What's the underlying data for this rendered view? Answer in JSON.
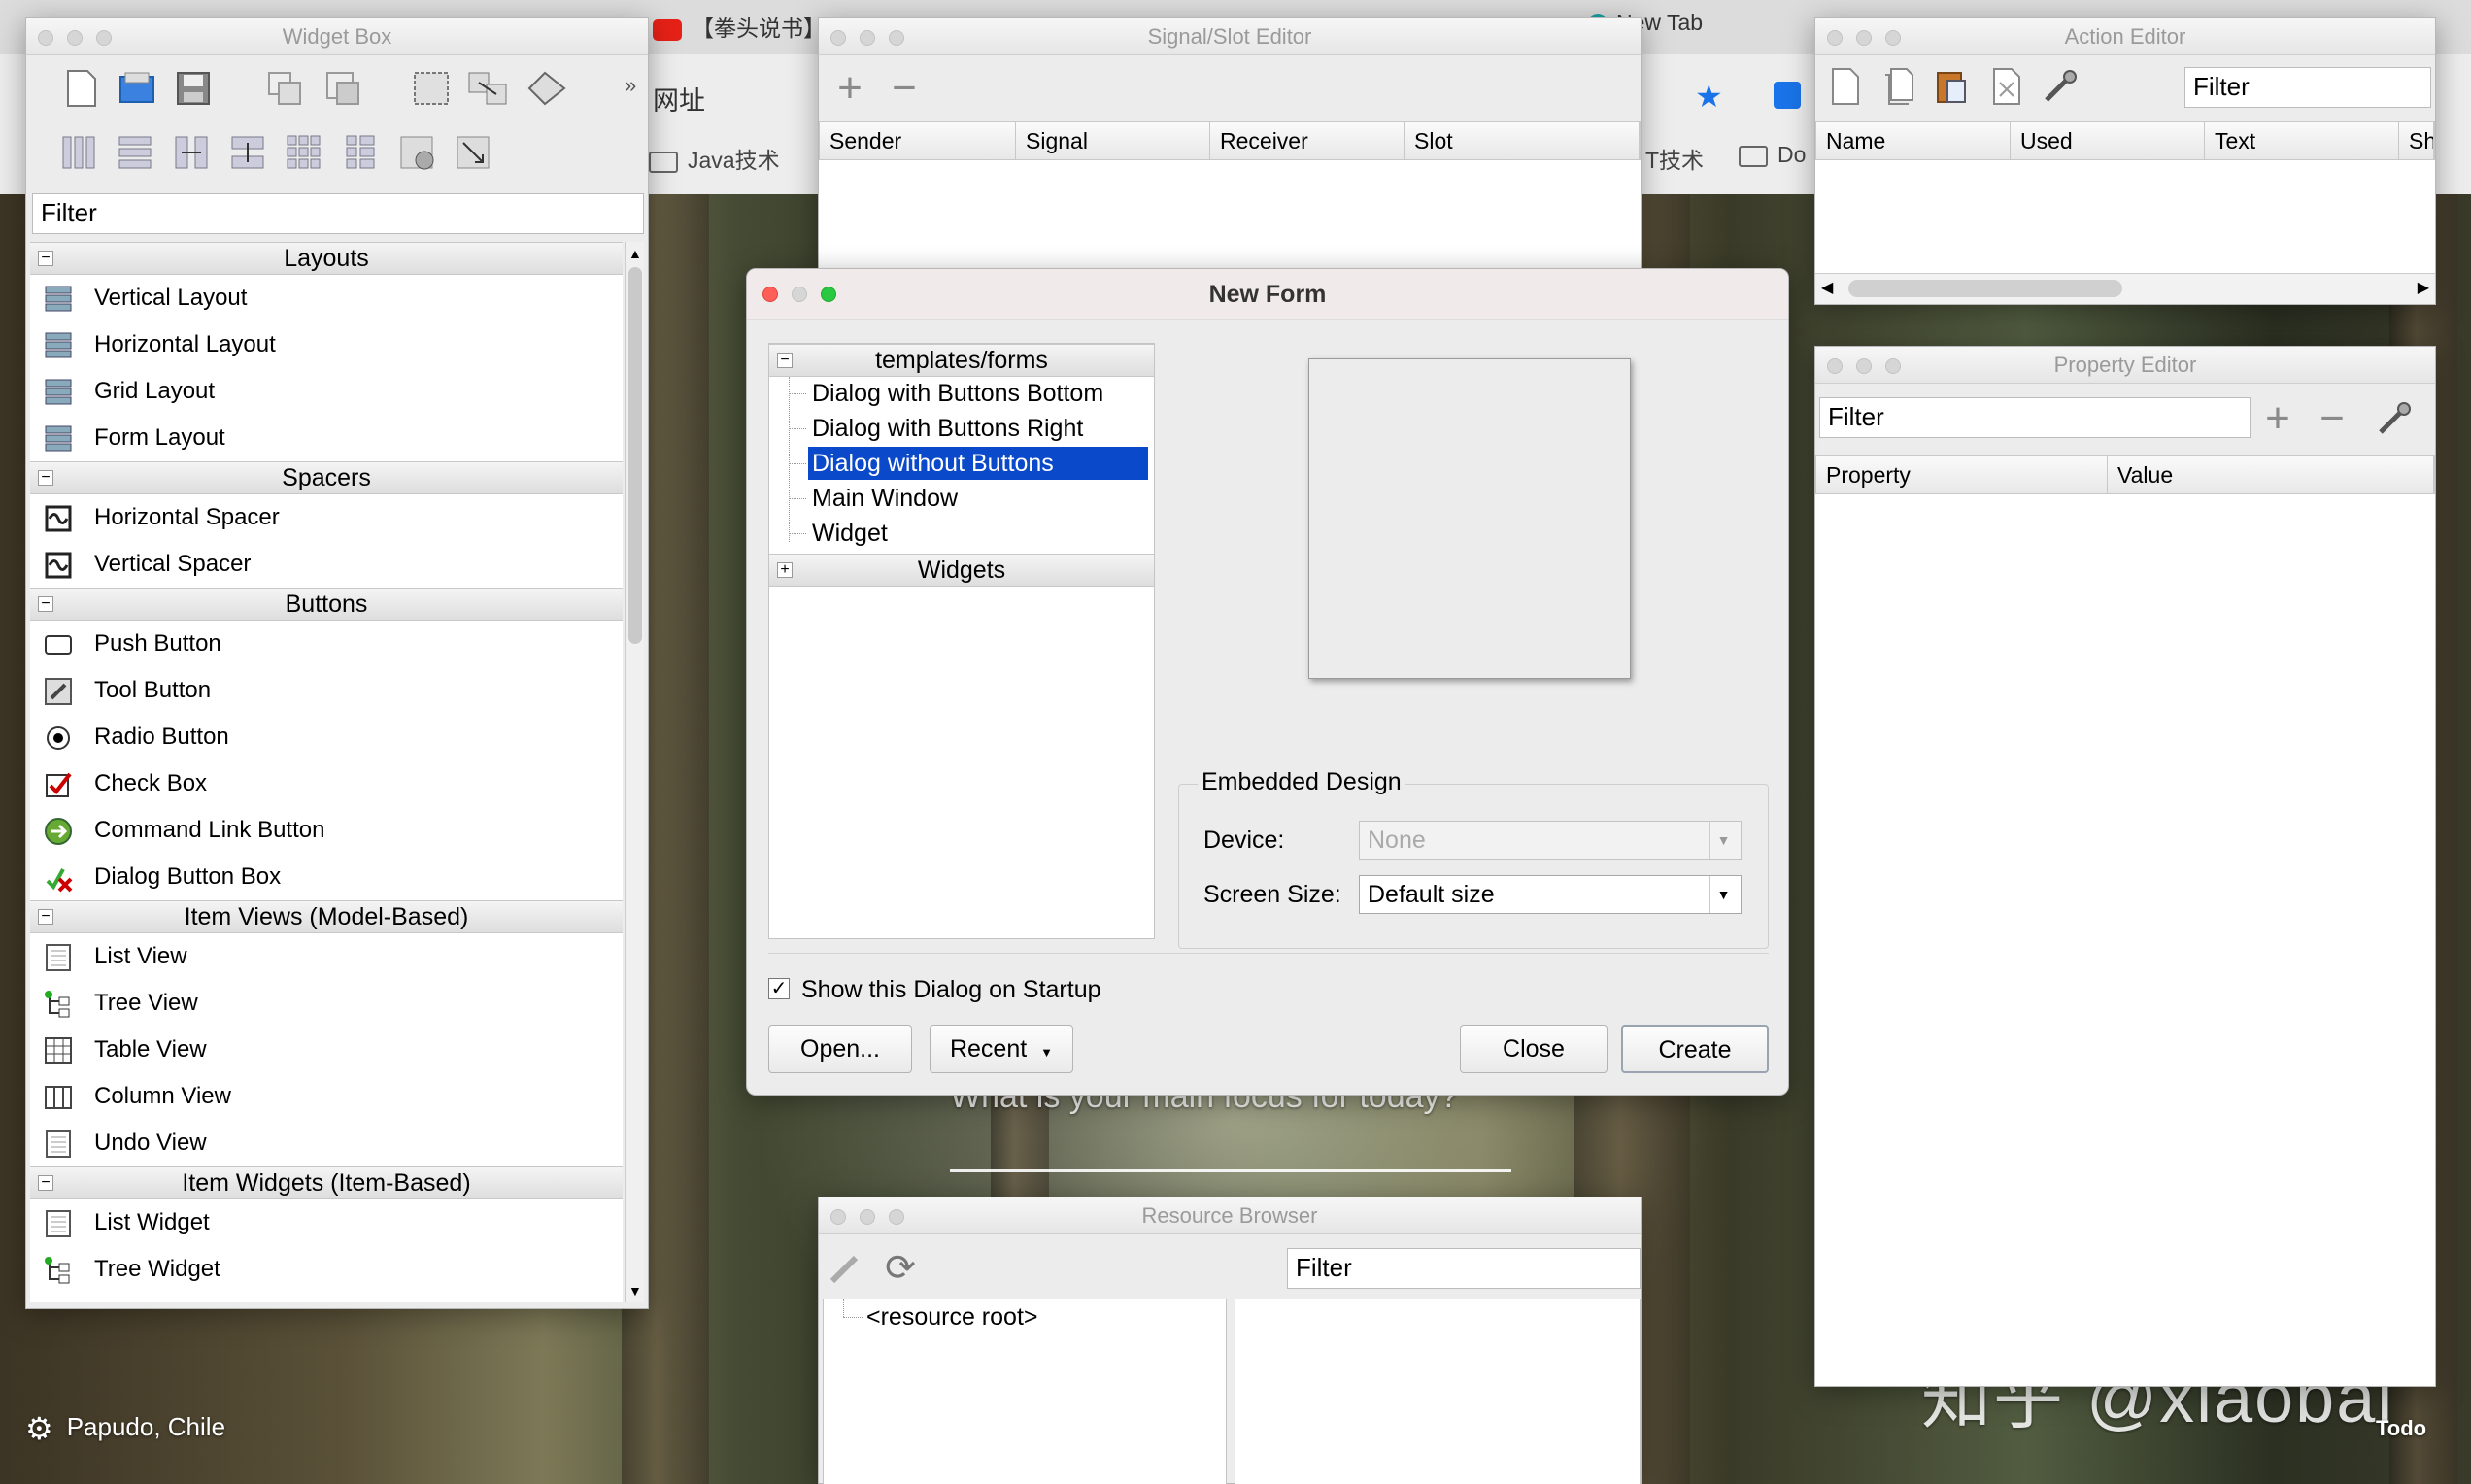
{
  "browser": {
    "tabs": [
      "【拳头说书】",
      "New Tab"
    ],
    "address_fragment": "网址",
    "bookmarks": [
      "Java技术",
      "T技术",
      "Do"
    ]
  },
  "desktop": {
    "location": "Papudo, Chile",
    "focus_prompt": "What is your main focus for today?",
    "todo": "Todo",
    "watermark": "知乎 @xiaobai"
  },
  "widget_box": {
    "title": "Widget Box",
    "more_glyph": "»",
    "filter_placeholder": "Filter",
    "categories": [
      {
        "name": "Layouts",
        "items": [
          "Vertical Layout",
          "Horizontal Layout",
          "Grid Layout",
          "Form Layout"
        ]
      },
      {
        "name": "Spacers",
        "items": [
          "Horizontal Spacer",
          "Vertical Spacer"
        ]
      },
      {
        "name": "Buttons",
        "items": [
          "Push Button",
          "Tool Button",
          "Radio Button",
          "Check Box",
          "Command Link Button",
          "Dialog Button Box"
        ]
      },
      {
        "name": "Item Views (Model-Based)",
        "items": [
          "List View",
          "Tree View",
          "Table View",
          "Column View",
          "Undo View"
        ]
      },
      {
        "name": "Item Widgets (Item-Based)",
        "items": [
          "List Widget",
          "Tree Widget"
        ]
      }
    ]
  },
  "signal_slot": {
    "title": "Signal/Slot Editor",
    "columns": [
      "Sender",
      "Signal",
      "Receiver",
      "Slot"
    ]
  },
  "action_editor": {
    "title": "Action Editor",
    "filter_placeholder": "Filter",
    "columns": [
      "Name",
      "Used",
      "Text",
      "Sh"
    ]
  },
  "property_editor": {
    "title": "Property Editor",
    "filter_placeholder": "Filter",
    "columns": [
      "Property",
      "Value"
    ]
  },
  "resource_browser": {
    "title": "Resource Browser",
    "filter_placeholder": "Filter",
    "root": "<resource root>"
  },
  "new_form": {
    "title": "New Form",
    "tree_header": "templates/forms",
    "templates": [
      "Dialog with Buttons Bottom",
      "Dialog with Buttons Right",
      "Dialog without Buttons",
      "Main Window",
      "Widget"
    ],
    "selected_index": 2,
    "widgets_group": "Widgets",
    "embedded_design": {
      "label": "Embedded Design",
      "device_label": "Device:",
      "device_value": "None",
      "screen_size_label": "Screen Size:",
      "screen_size_value": "Default size"
    },
    "show_on_startup_label": "Show this Dialog on Startup",
    "show_on_startup_checked": true,
    "buttons": {
      "open": "Open...",
      "recent": "Recent",
      "close": "Close",
      "create": "Create"
    }
  }
}
